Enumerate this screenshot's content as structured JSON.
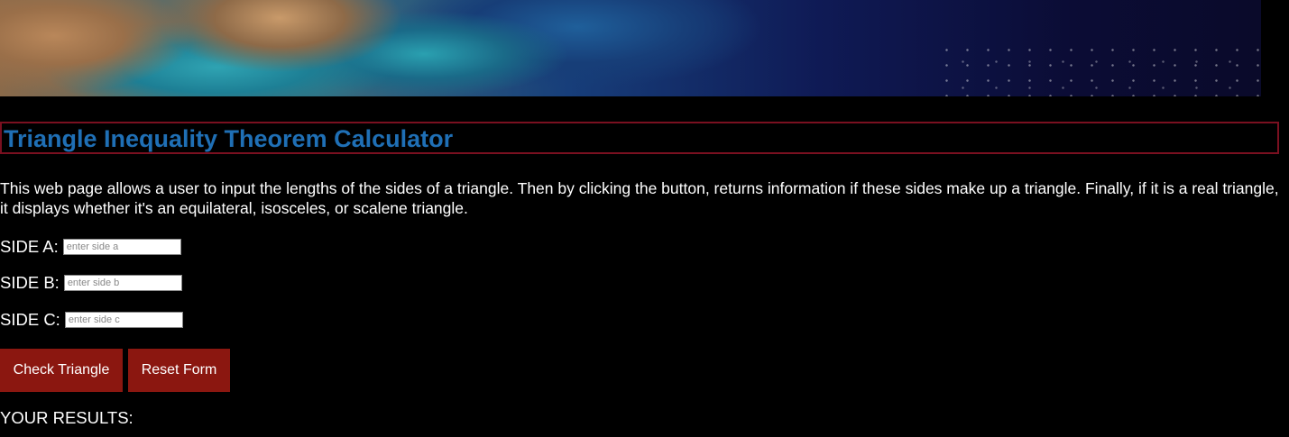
{
  "header": {
    "banner_image": "earth-from-space-banner"
  },
  "page": {
    "title": "Triangle Inequality Theorem Calculator",
    "description": "This web page allows a user to input the lengths of the sides of a triangle. Then by clicking the button, returns information if these sides make up a triangle. Finally, if it is a real triangle, it displays whether it's an equilateral, isosceles, or scalene triangle."
  },
  "form": {
    "side_a": {
      "label": "SIDE A:",
      "value": "",
      "placeholder": "enter side a"
    },
    "side_b": {
      "label": "SIDE B:",
      "value": "",
      "placeholder": "enter side b"
    },
    "side_c": {
      "label": "SIDE C:",
      "value": "",
      "placeholder": "enter side c"
    },
    "check_label": "Check Triangle",
    "reset_label": "Reset Form"
  },
  "results": {
    "heading": "YOUR RESULTS:"
  },
  "colors": {
    "background": "#000000",
    "title": "#1f6fb5",
    "title_border": "#7a1020",
    "button": "#8b1710",
    "text": "#ffffff"
  }
}
